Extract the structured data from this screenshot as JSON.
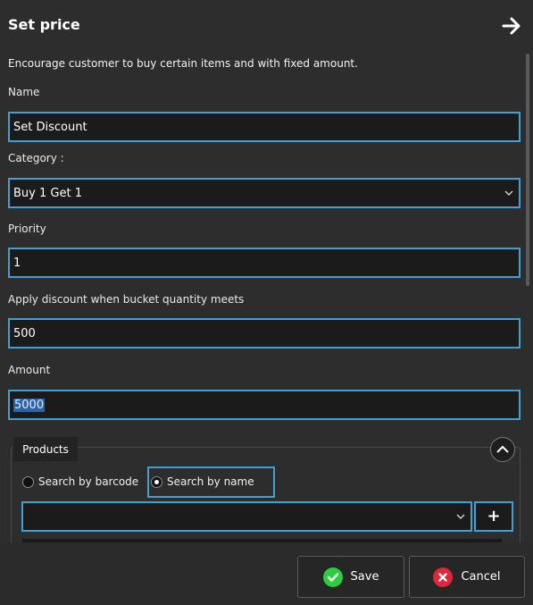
{
  "header": {
    "title": "Set price",
    "close_icon": "arrow-right-icon"
  },
  "description": "Encourage customer to buy certain items and with fixed amount.",
  "form": {
    "name_label": "Name",
    "name_value": "Set Discount",
    "category_label": "Category :",
    "category_value": "Buy 1 Get 1",
    "priority_label": "Priority",
    "priority_value": "1",
    "quantity_label": "Apply discount when bucket quantity meets",
    "quantity_value": "500",
    "amount_label": "Amount",
    "amount_value": "5000"
  },
  "products": {
    "title": "Products",
    "radio_barcode": "Search by barcode",
    "radio_name": "Search by name",
    "selected_radio": "name",
    "add_label": "+"
  },
  "footer": {
    "save_label": "Save",
    "cancel_label": "Cancel"
  },
  "colors": {
    "accent_border": "#3da1d6",
    "save_icon": "#2ecc40",
    "cancel_icon": "#e0263a"
  }
}
